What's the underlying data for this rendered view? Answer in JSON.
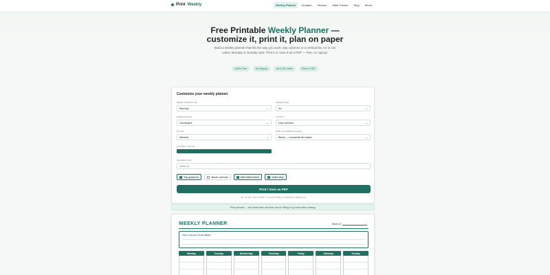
{
  "brand": {
    "name_plain": "Print",
    "name_accent": "Weekly"
  },
  "nav": [
    {
      "label": "Weekly Planner",
      "active": true
    },
    {
      "label": "Undated",
      "active": false
    },
    {
      "label": "Vertical",
      "active": false
    },
    {
      "label": "Habit Tracker",
      "active": false
    },
    {
      "label": "Blog",
      "active": false
    },
    {
      "label": "About",
      "active": false
    }
  ],
  "hero": {
    "title_prefix": "Free Printable",
    "title_accent": "Weekly Planner",
    "title_suffix": "—",
    "title_line2": "customize it, print it, plan on paper",
    "description": "Build a weekly planner that fits the way you work: day columns or a vertical list, A4 or US Letter, Monday or Sunday start. Print it or save it as a PDF — free, no signup.",
    "chips": [
      "100% Free",
      "No Signup",
      "A4 & US Letter",
      "Print or PDF"
    ]
  },
  "customize": {
    "title": "Customize your weekly planner",
    "week_starts_label": "Week starts on",
    "week_starts_value": "Monday",
    "paper_size_label": "Paper size",
    "paper_size_value": "A4",
    "orientation_label": "Orientation",
    "orientation_value": "Landscape",
    "layout_label": "Layout",
    "layout_value": "Day columns",
    "style_label": "Style",
    "style_value": "Minimal",
    "mini_calendar_label": "Mini calendar dates",
    "mini_calendar_value": "Blank — handwrite the dates",
    "accent_label": "Accent color",
    "accent_color": "#1f6f62",
    "header_text_label": "Header text",
    "header_text_value": "Week of",
    "toggles": [
      {
        "label": "Top goals box",
        "on": true
      },
      {
        "label": "Month calendar",
        "on": false
      },
      {
        "label": "Mini habit tracker",
        "on": true
      },
      {
        "label": "Notes strip",
        "on": true
      }
    ],
    "print_button": "Print / Save as PDF",
    "tip": "Tip: choose \"Save as PDF\" in the print dialog to download a digital copy."
  },
  "preview_banner": "Print preview — the blank cells and lines are for filling in by hand after printing.",
  "paper": {
    "title": "WEEKLY PLANNER",
    "week_of": "Week of",
    "goals_label": "TOP 3 GOALS THIS WEEK",
    "days": [
      "Monday",
      "Tuesday",
      "Wednesday",
      "Thursday",
      "Friday",
      "Saturday",
      "Sunday"
    ]
  },
  "colors": {
    "accent": "#1f6f62",
    "chip_bg": "#d7f0e6",
    "active_nav_bg": "#dff3ec"
  }
}
